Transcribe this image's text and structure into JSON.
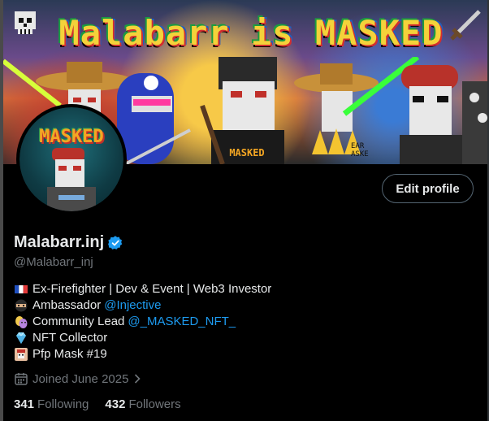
{
  "banner": {
    "title": "Malabarr is MASKED",
    "icons": [
      "skull-icon",
      "sword-icon"
    ]
  },
  "avatar": {
    "text": "MASKED"
  },
  "profile": {
    "edit_label": "Edit profile",
    "display_name": "Malabarr.inj",
    "handle": "@Malabarr_inj",
    "verified_color": "#1d9bf0"
  },
  "bio": {
    "line1": {
      "icon": "france-flag-icon",
      "text": "Ex-Firefighter | Dev & Event | Web3 Investor"
    },
    "line2": {
      "icon": "ninja-icon",
      "text": "Ambassador",
      "mention": "@Injective"
    },
    "line3": {
      "icon": "theater-masks-icon",
      "text": "Community Lead",
      "mention": "@_MASKED_NFT_"
    },
    "line4": {
      "icon": "gem-icon",
      "text": "NFT Collector"
    },
    "line5": {
      "icon": "pfp-mask-icon",
      "text": "Pfp Mask #19"
    }
  },
  "joined": {
    "text": "Joined June 2025"
  },
  "stats": {
    "following_count": "341",
    "following_label": "Following",
    "followers_count": "432",
    "followers_label": "Followers"
  },
  "colors": {
    "background": "#000000",
    "text": "#e7e9ea",
    "muted": "#71767b",
    "link": "#1d9bf0"
  }
}
